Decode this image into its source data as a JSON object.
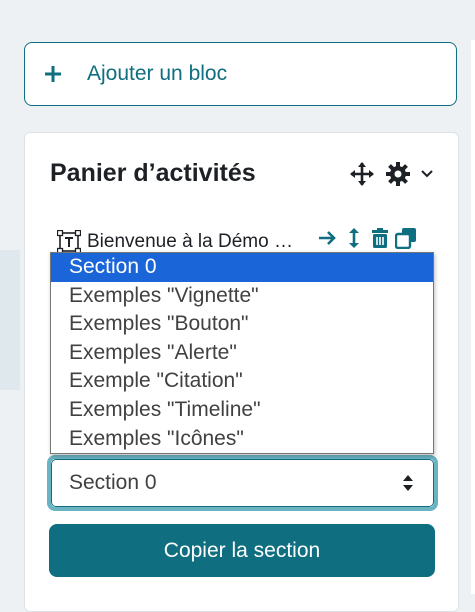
{
  "add_block": {
    "icon": "plus-icon",
    "label": "Ajouter un bloc"
  },
  "panel": {
    "title": "Panier d’activités",
    "controls": [
      "move-icon",
      "gear-icon",
      "chevron-down-icon"
    ]
  },
  "activity": {
    "icon": "text-activity-icon",
    "label": "Bienvenue à la Démo …",
    "tools": [
      "arrow-right-icon",
      "move-vertical-icon",
      "trash-icon",
      "duplicate-icon"
    ]
  },
  "section_select": {
    "value": "Section 0",
    "options": [
      "Section 0",
      "Exemples \"Vignette\"",
      "Exemples \"Bouton\"",
      "Exemples \"Alerte\"",
      "Exemple \"Citation\"",
      "Exemples \"Timeline\"",
      "Exemples \"Icônes\""
    ],
    "selected_index": 0
  },
  "copy_button": {
    "label": "Copier la section"
  },
  "colors": {
    "accent": "#0f6e80",
    "focus_ring": "#6ab3c2",
    "option_selected": "#1a65d8"
  }
}
